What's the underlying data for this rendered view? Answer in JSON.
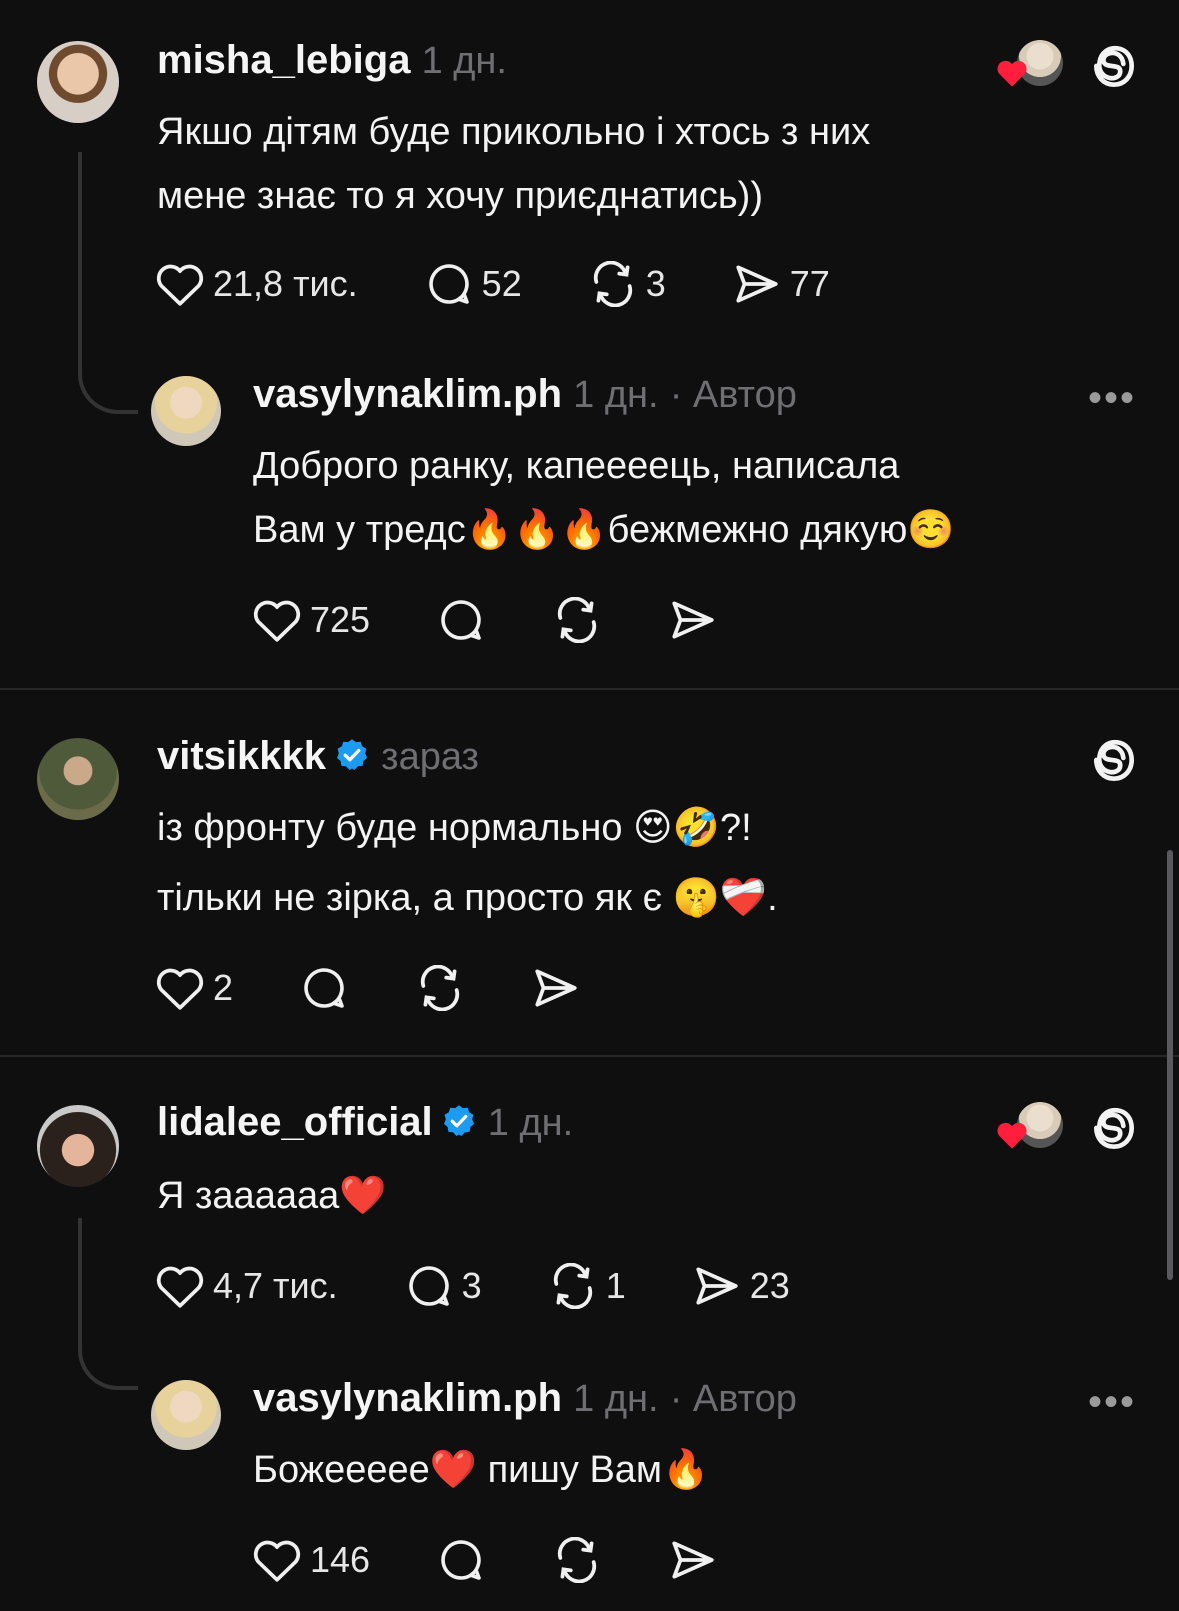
{
  "comments": [
    {
      "username": "misha_lebiga",
      "time": "1 дн.",
      "line1": "Якшо дітям буде прикольно і хтось з них",
      "line2": "мене знає то я хочу приєднатись))",
      "likes": "21,8 тис.",
      "replies": "52",
      "reposts": "3",
      "shares": "77",
      "reply": {
        "username": "vasylynaklim.ph",
        "time": "1 дн.",
        "author": "· Автор",
        "line1": "Доброго ранку, капеееець, написала",
        "line2": "Вам у тредс🔥🔥🔥бежмежно дякую☺️",
        "likes": "725"
      }
    },
    {
      "username": "vitsikkkk",
      "time": "зараз",
      "line1": "із фронту буде нормально 😍🤣?!",
      "line2": "тільки не зірка, а просто як є 🤫❤️‍🩹.",
      "likes": "2"
    },
    {
      "username": "lidalee_official",
      "time": "1 дн.",
      "line1": "Я зааааaa❤️",
      "likes": "4,7 тис.",
      "replies": "3",
      "reposts": "1",
      "shares": "23",
      "reply": {
        "username": "vasylynaklim.ph",
        "time": "1 дн.",
        "author": "· Автор",
        "line1": "Божееееe❤️ пишу Вам🔥",
        "likes": "146"
      }
    }
  ],
  "more_label": "•••",
  "colors": {
    "background": "#0f0f10",
    "verified": "#1d9bf0",
    "liked_heart": "#ff1f3d",
    "muted": "#6f6f72"
  }
}
